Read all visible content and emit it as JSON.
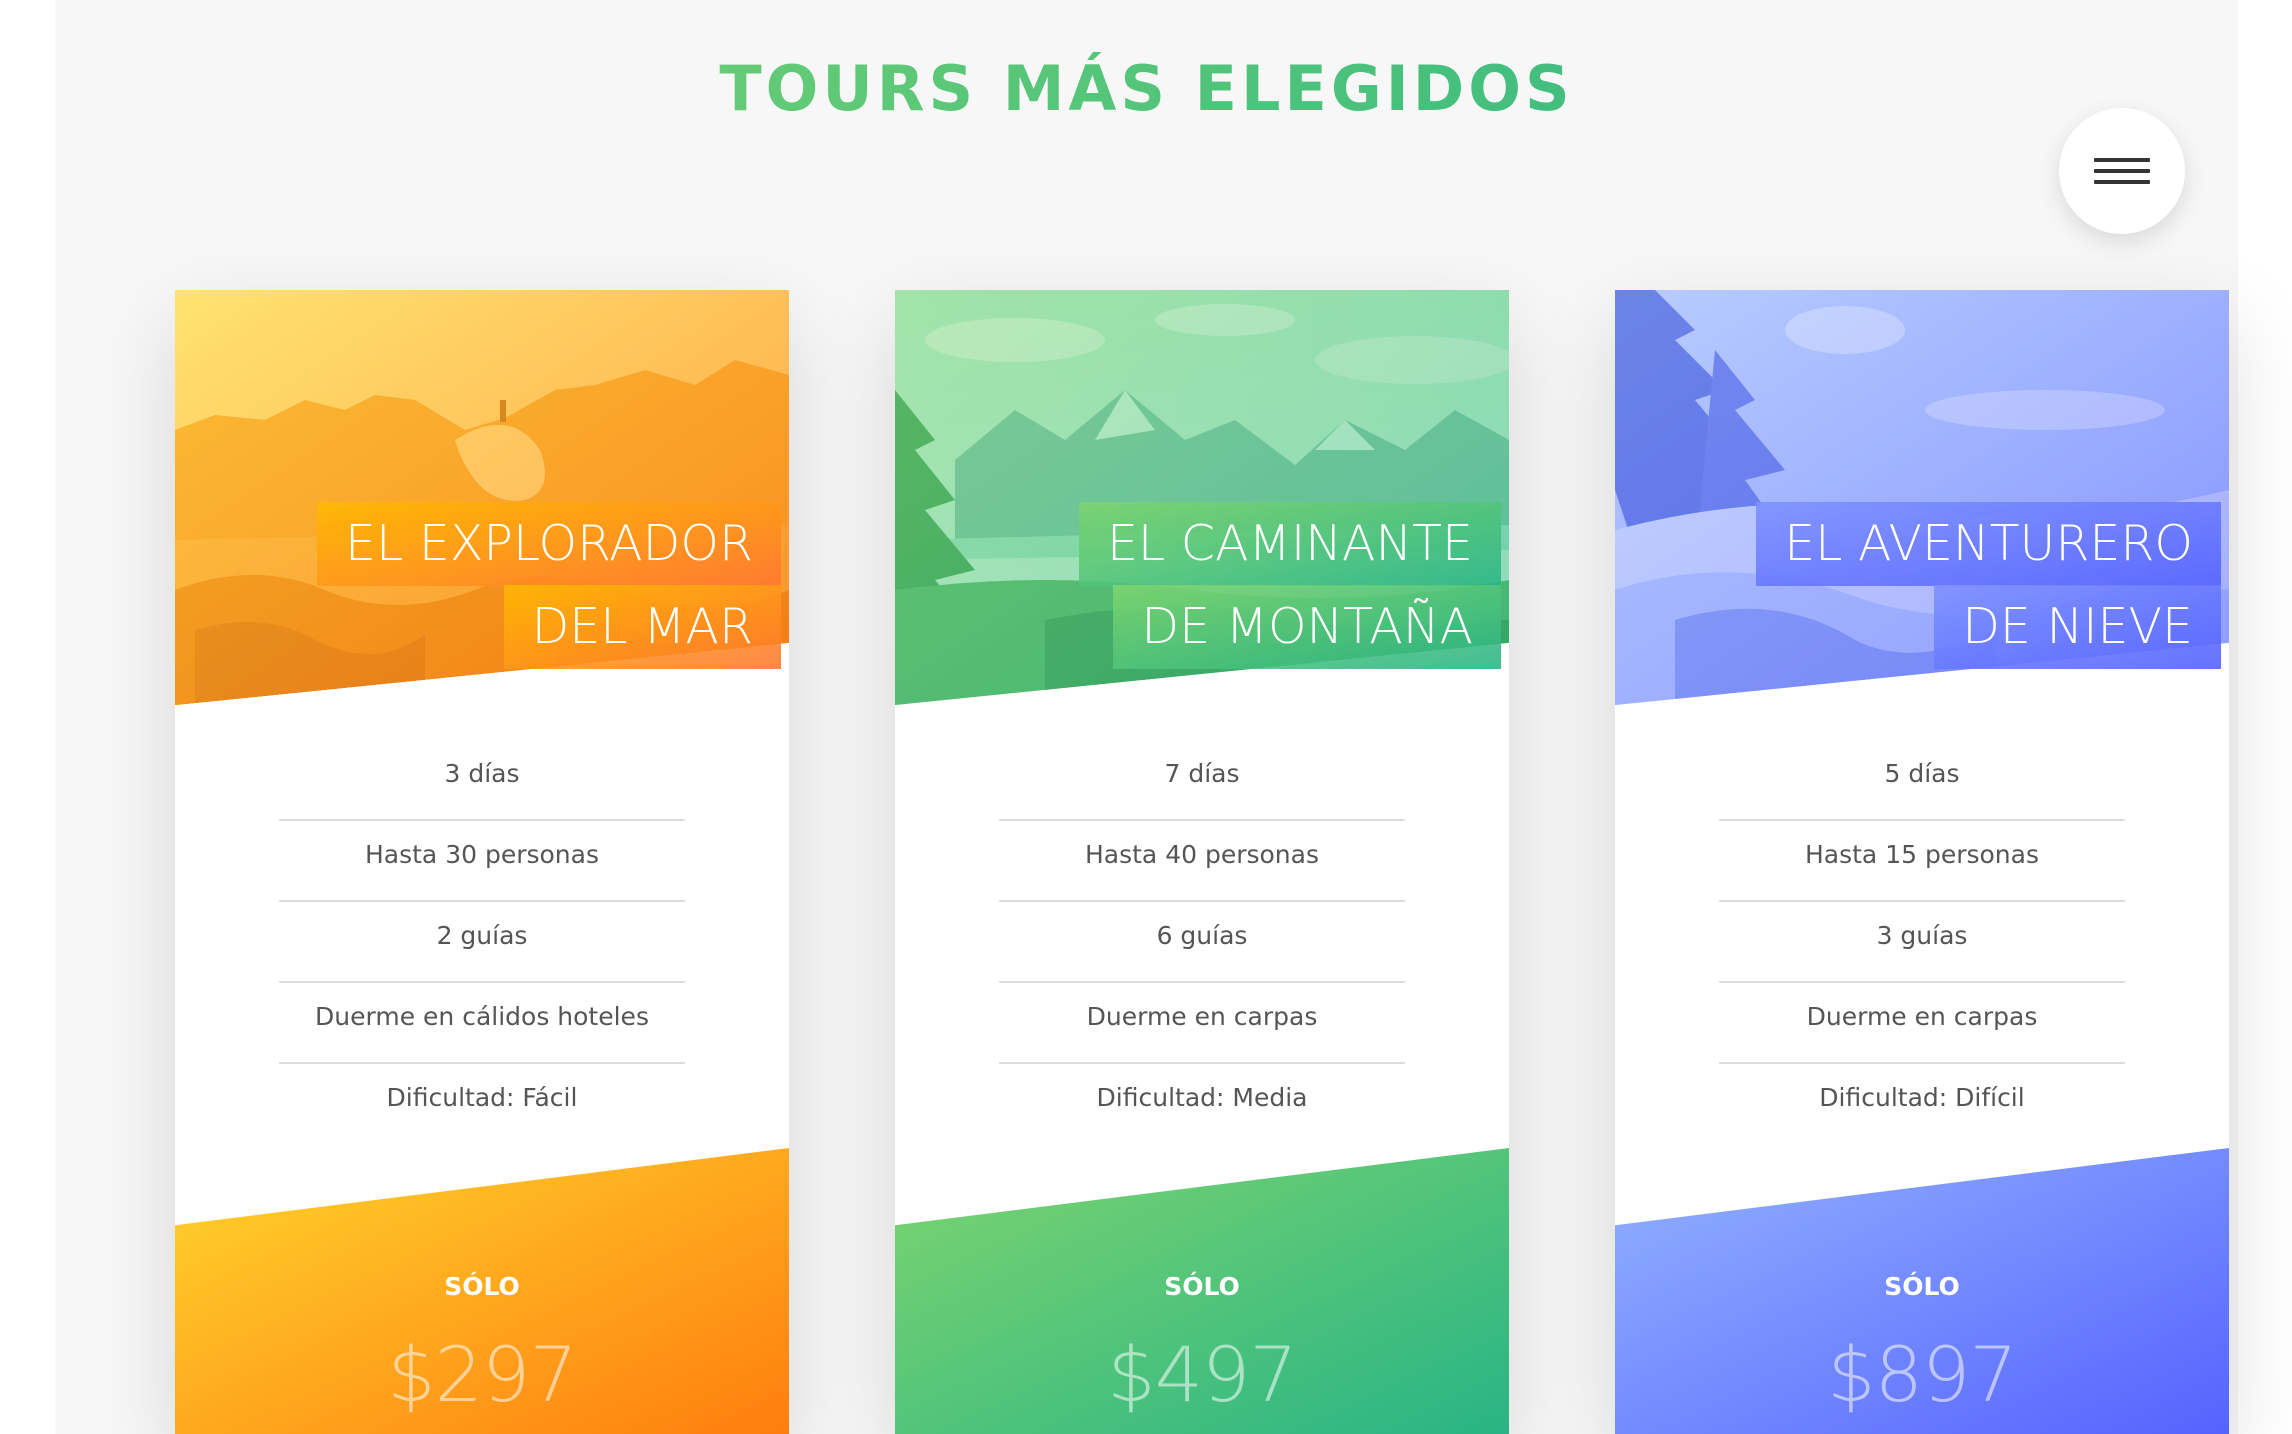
{
  "section": {
    "title": "TOURS MÁS ELEGIDOS"
  },
  "menu": {
    "icon": "hamburger-menu-icon"
  },
  "cards": [
    {
      "theme": "orange",
      "colors": {
        "from": "#ffd52e",
        "to": "#ff7d0e"
      },
      "heading_line1": "EL EXPLORADOR",
      "heading_line2": "DEL MAR",
      "details": [
        "3 días",
        "Hasta 30 personas",
        "2 guías",
        "Duerme en cálidos hoteles",
        "Dificultad: Fácil"
      ],
      "price_label": "SÓLO",
      "price": "$297"
    },
    {
      "theme": "green",
      "colors": {
        "from": "#7ed56f",
        "to": "#28b485"
      },
      "heading_line1": "EL CAMINANTE",
      "heading_line2": "DE MONTAÑA",
      "details": [
        "7 días",
        "Hasta 40 personas",
        "6 guías",
        "Duerme en carpas",
        "Dificultad: Media"
      ],
      "price_label": "SÓLO",
      "price": "$497"
    },
    {
      "theme": "blue",
      "colors": {
        "from": "#93b3ff",
        "to": "#5563ff"
      },
      "heading_line1": "EL AVENTURERO",
      "heading_line2": "DE NIEVE",
      "details": [
        "5 días",
        "Hasta 15 personas",
        "3 guías",
        "Duerme en carpas",
        "Dificultad: Difícil"
      ],
      "price_label": "SÓLO",
      "price": "$897"
    }
  ]
}
